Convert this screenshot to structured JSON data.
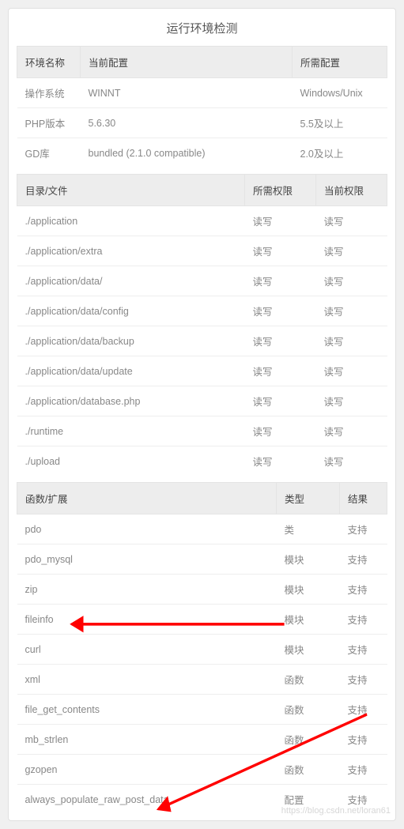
{
  "page_title": "运行环境检测",
  "env_table": {
    "headers": {
      "name": "环境名称",
      "current": "当前配置",
      "required": "所需配置"
    },
    "rows": [
      {
        "name": "操作系统",
        "current": "WINNT",
        "required": "Windows/Unix"
      },
      {
        "name": "PHP版本",
        "current": "5.6.30",
        "required": "5.5及以上"
      },
      {
        "name": "GD库",
        "current": "bundled (2.1.0 compatible)",
        "required": "2.0及以上"
      }
    ]
  },
  "dir_table": {
    "headers": {
      "path": "目录/文件",
      "required": "所需权限",
      "current": "当前权限"
    },
    "rows": [
      {
        "path": "./application",
        "required": "读写",
        "current": "读写"
      },
      {
        "path": "./application/extra",
        "required": "读写",
        "current": "读写"
      },
      {
        "path": "./application/data/",
        "required": "读写",
        "current": "读写"
      },
      {
        "path": "./application/data/config",
        "required": "读写",
        "current": "读写"
      },
      {
        "path": "./application/data/backup",
        "required": "读写",
        "current": "读写"
      },
      {
        "path": "./application/data/update",
        "required": "读写",
        "current": "读写"
      },
      {
        "path": "./application/database.php",
        "required": "读写",
        "current": "读写"
      },
      {
        "path": "./runtime",
        "required": "读写",
        "current": "读写"
      },
      {
        "path": "./upload",
        "required": "读写",
        "current": "读写"
      }
    ]
  },
  "ext_table": {
    "headers": {
      "name": "函数/扩展",
      "type": "类型",
      "result": "结果"
    },
    "rows": [
      {
        "name": "pdo",
        "type": "类",
        "result": "支持"
      },
      {
        "name": "pdo_mysql",
        "type": "模块",
        "result": "支持"
      },
      {
        "name": "zip",
        "type": "模块",
        "result": "支持"
      },
      {
        "name": "fileinfo",
        "type": "模块",
        "result": "支持"
      },
      {
        "name": "curl",
        "type": "模块",
        "result": "支持"
      },
      {
        "name": "xml",
        "type": "函数",
        "result": "支持"
      },
      {
        "name": "file_get_contents",
        "type": "函数",
        "result": "支持"
      },
      {
        "name": "mb_strlen",
        "type": "函数",
        "result": "支持"
      },
      {
        "name": "gzopen",
        "type": "函数",
        "result": "支持"
      },
      {
        "name": "always_populate_raw_post_data",
        "type": "配置",
        "result": "支持"
      }
    ]
  },
  "watermark": "https://blog.csdn.net/loran61",
  "annotation": {
    "color": "#ff0000"
  }
}
